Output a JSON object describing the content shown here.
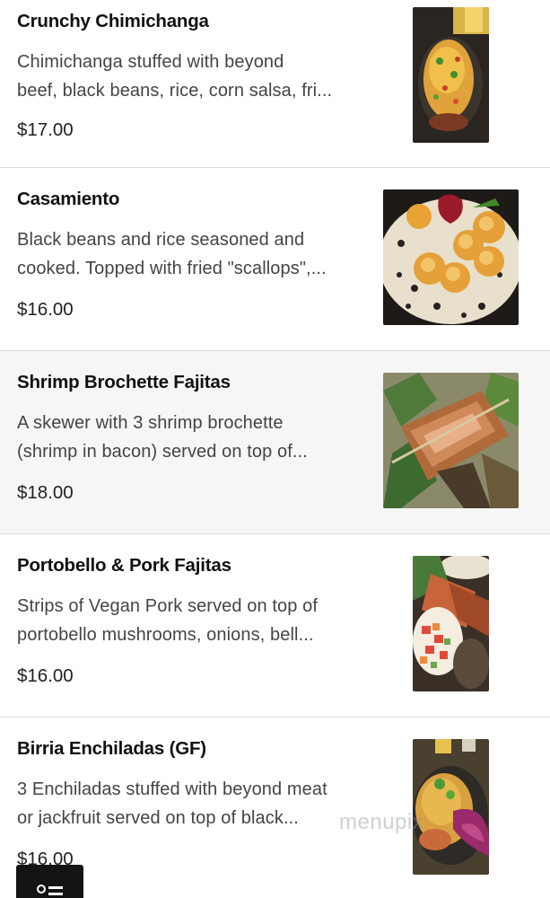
{
  "menu": {
    "items": [
      {
        "name": "Crunchy Chimichanga",
        "desc_line1": "Chimichanga stuffed with beyond",
        "desc_line2": "beef, black beans, rice, corn salsa, fri...",
        "price": "$17.00",
        "photo_icon": "chimichanga-photo"
      },
      {
        "name": "Casamiento",
        "desc_line1": "Black beans and rice seasoned and",
        "desc_line2": "cooked. Topped with fried \"scallops\",...",
        "price": "$16.00",
        "photo_icon": "casamiento-photo"
      },
      {
        "name": "Shrimp Brochette Fajitas",
        "desc_line1": "A skewer with 3 shrimp brochette",
        "desc_line2": "(shrimp in bacon) served on top of...",
        "price": "$18.00",
        "photo_icon": "fajitas-photo"
      },
      {
        "name": "Portobello & Pork Fajitas",
        "desc_line1": "Strips of Vegan Pork served on top of",
        "desc_line2": "portobello mushrooms, onions, bell...",
        "price": "$16.00",
        "photo_icon": "portobello-photo"
      },
      {
        "name": "Birria Enchiladas (GF)",
        "desc_line1": "3 Enchiladas stuffed with beyond meat",
        "desc_line2": "or jackfruit served on top of black...",
        "price": "$16.00",
        "photo_icon": "enchiladas-photo"
      }
    ]
  },
  "fab": {
    "icon": "menu-list-icon"
  },
  "watermark": {
    "text": "menupix"
  },
  "colors": {
    "divider": "#dcdcdc",
    "shaded_row": "#f6f6f6",
    "fab": "#141414"
  }
}
